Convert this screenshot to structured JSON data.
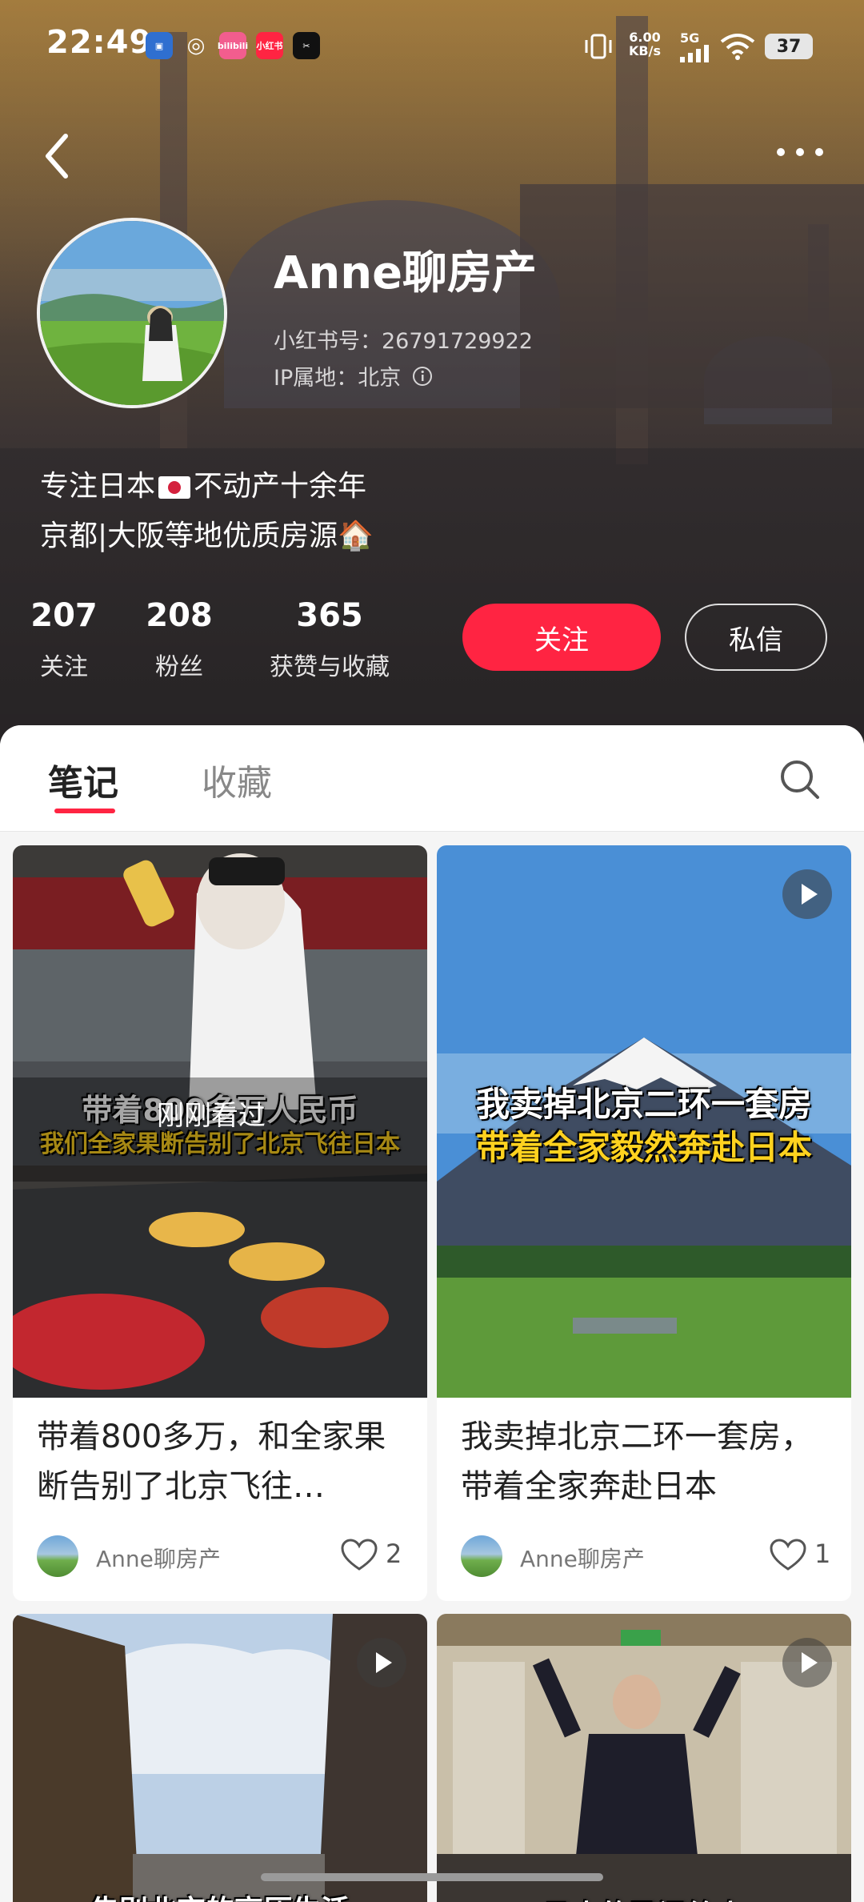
{
  "status_bar": {
    "time": "22:49",
    "app_icons": [
      "bilibili",
      "小红书"
    ],
    "net_speed_value": "6.00",
    "net_speed_unit": "KB/s",
    "network": "5G",
    "battery": "37"
  },
  "profile": {
    "name": "Anne聊房产",
    "id_line": "小红书号：26791729922",
    "ip_line": "IP属地：北京",
    "bio_line1_pre": "专注日本",
    "bio_line1_post": "不动产十余年",
    "bio_line2": "京都|大阪等地优质房源🏠"
  },
  "stats": [
    {
      "value": "207",
      "label": "关注"
    },
    {
      "value": "208",
      "label": "粉丝"
    },
    {
      "value": "365",
      "label": "获赞与收藏"
    }
  ],
  "actions": {
    "follow": "关注",
    "message": "私信"
  },
  "tabs": {
    "notes": "笔记",
    "favorites": "收藏"
  },
  "notes": [
    {
      "title": "带着800多万，和全家果断告别了北京飞往…",
      "caption_white": "带着800多万人民币",
      "caption_yellow": "我们全家果断告别了北京飞往日本",
      "badge": "刚刚看过",
      "author": "Anne聊房产",
      "likes": "2"
    },
    {
      "title": "我卖掉北京二环一套房，带着全家奔赴日本",
      "caption_white": "我卖掉北京二环一套房",
      "caption_yellow": "带着全家毅然奔赴日本",
      "author": "Anne聊房产",
      "likes": "1"
    },
    {
      "caption_white": "告别北京的高压生活"
    },
    {
      "caption_white": "日本的民间给人"
    }
  ],
  "colors": {
    "accent": "#ff2442",
    "tab_indicator": "#ff2442"
  }
}
